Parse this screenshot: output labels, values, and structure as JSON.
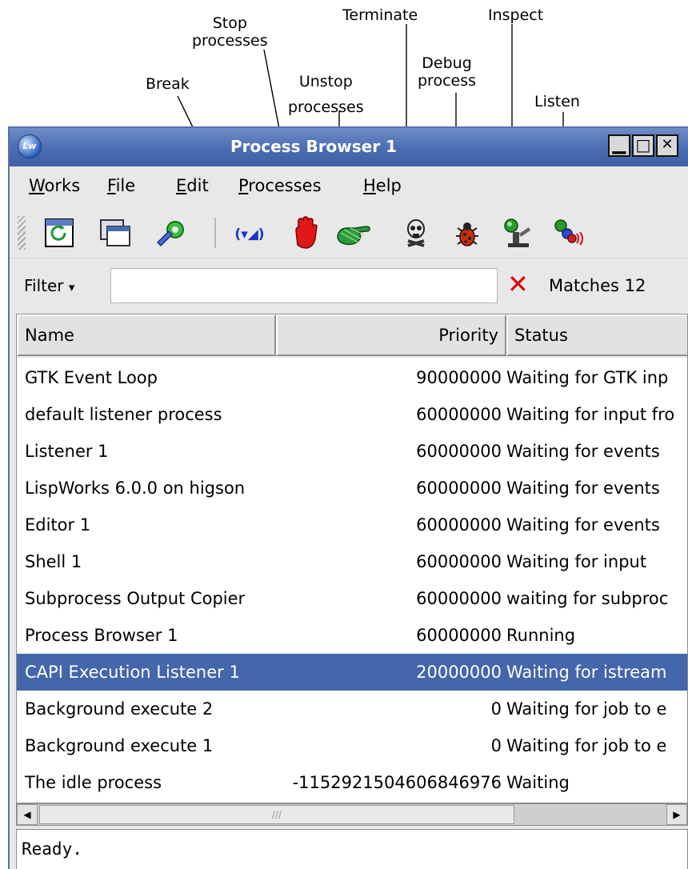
{
  "callouts": {
    "stop": "Stop\nprocesses",
    "terminate": "Terminate",
    "inspect": "Inspect",
    "debug": "Debug\nprocess",
    "break": "Break",
    "unstop": "Unstop\nprocesses",
    "listen": "Listen"
  },
  "window": {
    "title": "Process Browser 1",
    "minimize": "▁",
    "maximize": "□",
    "close": "✕"
  },
  "menu": [
    {
      "label": "Works",
      "mnemonic": "W"
    },
    {
      "label": "File",
      "mnemonic": "F"
    },
    {
      "label": "Edit",
      "mnemonic": "E"
    },
    {
      "label": "Processes",
      "mnemonic": "P"
    },
    {
      "label": "Help",
      "mnemonic": "H"
    }
  ],
  "toolbar_icons": [
    "refresh-icon",
    "window-icon",
    "preferences-icon",
    "break-icon",
    "stop-hand-icon",
    "unstop-hand-icon",
    "terminate-skull-icon",
    "debug-bug-icon",
    "inspect-icon",
    "listen-icon"
  ],
  "filter": {
    "label": "Filter",
    "value": "",
    "matches": "Matches 12"
  },
  "table": {
    "columns": [
      "Name",
      "Priority",
      "Status"
    ],
    "rows": [
      {
        "name": "GTK Event Loop",
        "priority": "90000000",
        "status": "Waiting for GTK inp"
      },
      {
        "name": "default listener process",
        "priority": "60000000",
        "status": "Waiting for input fro"
      },
      {
        "name": "Listener 1",
        "priority": "60000000",
        "status": "Waiting for events"
      },
      {
        "name": "LispWorks 6.0.0 on higson",
        "priority": "60000000",
        "status": "Waiting for events"
      },
      {
        "name": "Editor 1",
        "priority": "60000000",
        "status": "Waiting for events"
      },
      {
        "name": "Shell 1",
        "priority": "60000000",
        "status": "Waiting for input"
      },
      {
        "name": "Subprocess Output Copier",
        "priority": "60000000",
        "status": "waiting for subproc"
      },
      {
        "name": "Process Browser 1",
        "priority": "60000000",
        "status": "Running"
      },
      {
        "name": "CAPI Execution Listener 1",
        "priority": "20000000",
        "status": "Waiting for istream",
        "selected": true
      },
      {
        "name": "Background execute 2",
        "priority": "0",
        "status": "Waiting for job to e"
      },
      {
        "name": "Background execute 1",
        "priority": "0",
        "status": "Waiting for job to e"
      },
      {
        "name": "The idle process",
        "priority": "-1152921504606846976",
        "status": "Waiting"
      }
    ]
  },
  "scrollbar": {
    "left_arrow": "◀",
    "right_arrow": "▶",
    "grip": "///"
  },
  "status_text": "Ready.",
  "colors": {
    "titlebar": "#4a6cb3",
    "selection": "#4466aa",
    "clear_x": "#e00000"
  }
}
